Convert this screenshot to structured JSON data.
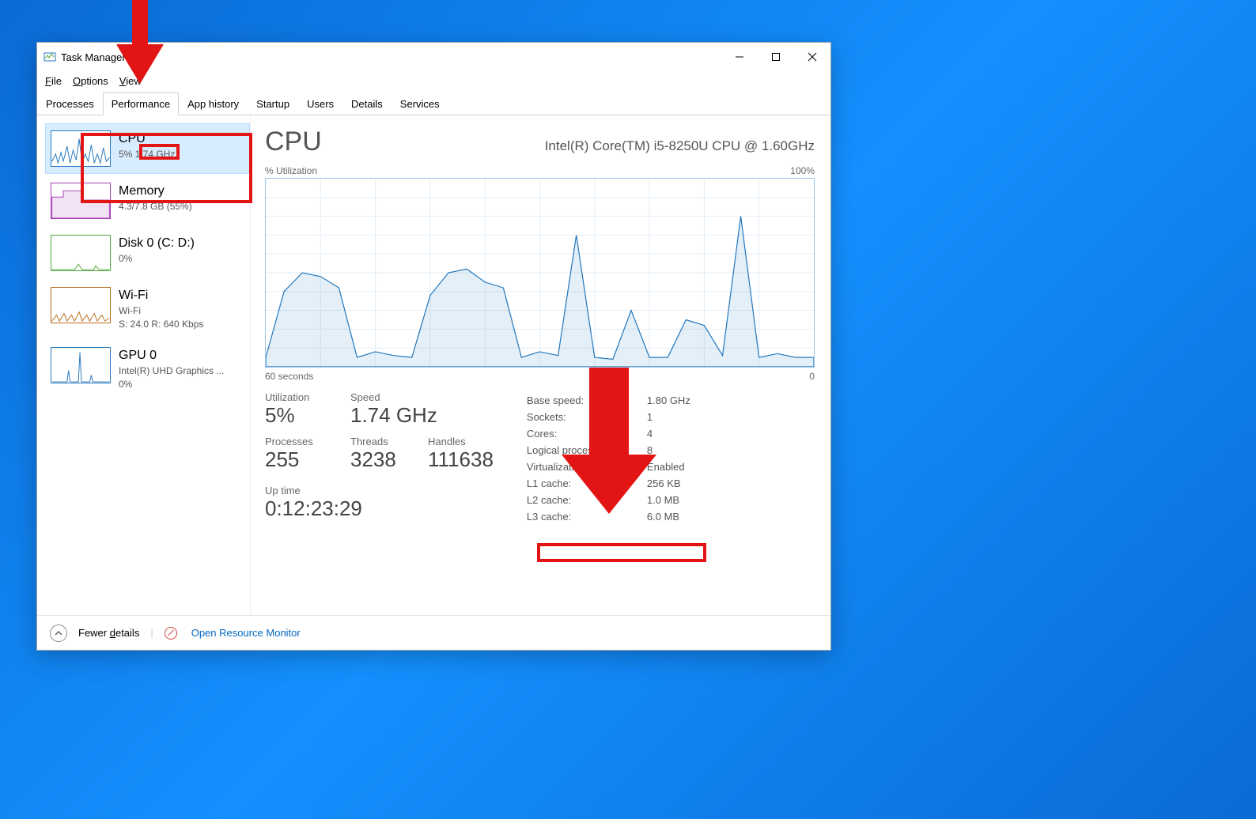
{
  "window": {
    "title": "Task Manager"
  },
  "menubar": [
    "File",
    "Options",
    "View"
  ],
  "tabs": [
    "Processes",
    "Performance",
    "App history",
    "Startup",
    "Users",
    "Details",
    "Services"
  ],
  "active_tab": "Performance",
  "sidebar": [
    {
      "title": "CPU",
      "sub1": "5%  1.74 GHz",
      "sub2": "",
      "color": "#2578be"
    },
    {
      "title": "Memory",
      "sub1": "4.3/7.8 GB (55%)",
      "sub2": "",
      "color": "#a63ab2"
    },
    {
      "title": "Disk 0 (C: D:)",
      "sub1": "0%",
      "sub2": "",
      "color": "#4fa83d"
    },
    {
      "title": "Wi-Fi",
      "sub1": "Wi-Fi",
      "sub2": "S: 24.0  R: 640 Kbps",
      "color": "#b86b1a"
    },
    {
      "title": "GPU 0",
      "sub1": "Intel(R) UHD Graphics ...",
      "sub2": "0%",
      "color": "#2578be"
    }
  ],
  "main": {
    "heading": "CPU",
    "model": "Intel(R) Core(TM) i5-8250U CPU @ 1.60GHz",
    "chart_top_left": "% Utilization",
    "chart_top_right": "100%",
    "chart_bottom_left": "60 seconds",
    "chart_bottom_right": "0",
    "big": [
      {
        "label": "Utilization",
        "value": "5%"
      },
      {
        "label": "Speed",
        "value": "1.74 GHz"
      },
      {
        "label": "Processes",
        "value": "255"
      },
      {
        "label": "Threads",
        "value": "3238"
      },
      {
        "label": "Handles",
        "value": "111638"
      }
    ],
    "uptime_label": "Up time",
    "uptime_value": "0:12:23:29",
    "specs": [
      {
        "k": "Base speed:",
        "v": "1.80 GHz"
      },
      {
        "k": "Sockets:",
        "v": "1"
      },
      {
        "k": "Cores:",
        "v": "4"
      },
      {
        "k": "Logical processors:",
        "v": "8"
      },
      {
        "k": "Virtualization:",
        "v": "Enabled",
        "highlight": true
      },
      {
        "k": "L1 cache:",
        "v": "256 KB"
      },
      {
        "k": "L2 cache:",
        "v": "1.0 MB"
      },
      {
        "k": "L3 cache:",
        "v": "6.0 MB"
      }
    ]
  },
  "footer": {
    "fewer": "Fewer details",
    "resmon": "Open Resource Monitor"
  },
  "chart_data": {
    "type": "line",
    "title": "% Utilization",
    "xlabel": "seconds",
    "ylabel": "% Utilization",
    "xlim": [
      60,
      0
    ],
    "ylim": [
      0,
      100
    ],
    "x": [
      60,
      58,
      56,
      54,
      52,
      50,
      48,
      46,
      44,
      42,
      40,
      38,
      36,
      34,
      32,
      30,
      28,
      26,
      24,
      22,
      20,
      18,
      16,
      14,
      12,
      10,
      8,
      6,
      4,
      2,
      0
    ],
    "values": [
      5,
      40,
      50,
      48,
      42,
      5,
      8,
      6,
      5,
      38,
      50,
      52,
      45,
      42,
      5,
      8,
      6,
      70,
      5,
      4,
      30,
      5,
      5,
      25,
      22,
      6,
      80,
      5,
      7,
      5,
      5
    ]
  }
}
